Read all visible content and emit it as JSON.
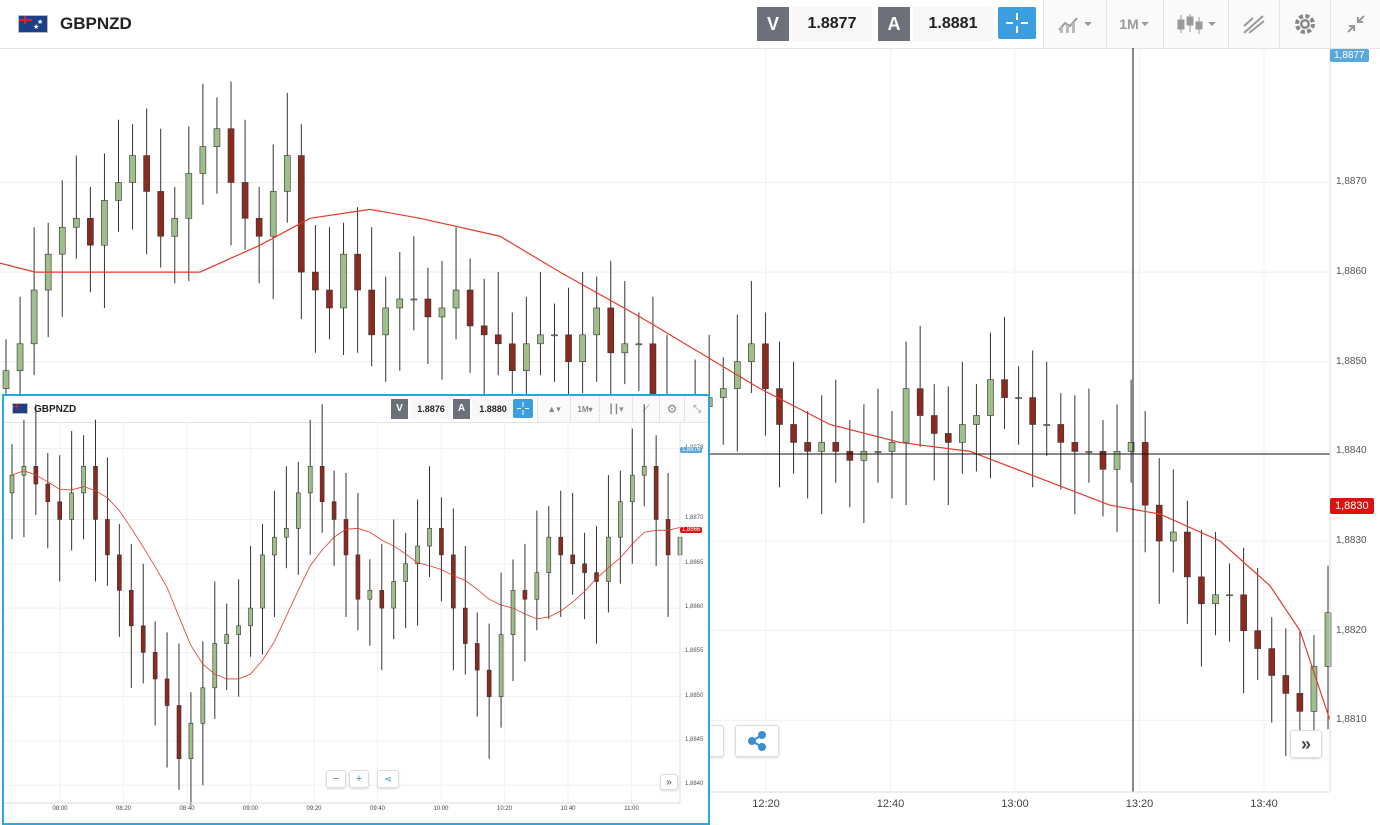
{
  "main": {
    "symbol": "GBPNZD",
    "sell_label": "V",
    "sell_price": "1.8877",
    "buy_label": "A",
    "buy_price": "1.8881",
    "timeframe": "1M",
    "current_price_tag": "1,8877",
    "ma_price_tag": "1,8830",
    "accent_color": "#3a9ee0",
    "bear_color": "#8b2a1f",
    "bull_color": "#9fbf8a",
    "ma_color": "#e53b2b"
  },
  "inset": {
    "symbol": "GBPNZD",
    "sell_label": "V",
    "sell_price": "1.8876",
    "buy_label": "A",
    "buy_price": "1.8880",
    "timeframe": "1M",
    "current_price_tag": "1,8876",
    "ma_price_tag": "1,8866",
    "zoom_out": "−",
    "zoom_in": "+"
  },
  "chart_data": [
    {
      "type": "candlestick",
      "title": "GBPNZD",
      "ylim": [
        1.8802,
        1.8885
      ],
      "yticks": [
        "1,8870",
        "1,8860",
        "1,8850",
        "1,8840",
        "1,8830",
        "1,8820",
        "1,8810"
      ],
      "xticks": [
        "12:20",
        "12:40",
        "13:00",
        "13:20",
        "13:40"
      ],
      "crosshair": {
        "time": "13:19",
        "price": 1.8835
      },
      "moving_average": [
        [
          0,
          1.8861
        ],
        [
          35,
          1.886
        ],
        [
          110,
          1.886
        ],
        [
          200,
          1.886
        ],
        [
          260,
          1.8863
        ],
        [
          310,
          1.8866
        ],
        [
          370,
          1.8867
        ],
        [
          420,
          1.8866
        ],
        [
          500,
          1.8864
        ],
        [
          560,
          1.886
        ],
        [
          640,
          1.8855
        ],
        [
          700,
          1.8851
        ],
        [
          760,
          1.8847
        ],
        [
          830,
          1.8843
        ],
        [
          900,
          1.8841
        ],
        [
          970,
          1.884
        ],
        [
          1040,
          1.8837
        ],
        [
          1110,
          1.8834
        ],
        [
          1160,
          1.8833
        ],
        [
          1220,
          1.883
        ],
        [
          1270,
          1.8825
        ],
        [
          1300,
          1.882
        ],
        [
          1330,
          1.881
        ]
      ],
      "closes": [
        1.8849,
        1.8852,
        1.8858,
        1.8862,
        1.8865,
        1.8866,
        1.8863,
        1.8868,
        1.887,
        1.8873,
        1.8869,
        1.8864,
        1.8866,
        1.8871,
        1.8874,
        1.8876,
        1.887,
        1.8866,
        1.8864,
        1.8869,
        1.8873,
        1.886,
        1.8858,
        1.8856,
        1.8862,
        1.8858,
        1.8853,
        1.8856,
        1.8857,
        1.8857,
        1.8855,
        1.8856,
        1.8858,
        1.8854,
        1.8853,
        1.8852,
        1.8849,
        1.8852,
        1.8853,
        1.8853,
        1.885,
        1.8853,
        1.8856,
        1.8851,
        1.8852,
        1.8852,
        1.8846,
        1.8838,
        1.8842,
        1.8845,
        1.8846,
        1.8847,
        1.885,
        1.8852,
        1.8847,
        1.8843,
        1.8841,
        1.884,
        1.8841,
        1.884,
        1.8839,
        1.884,
        1.884,
        1.8841,
        1.8847,
        1.8844,
        1.8842,
        1.8841,
        1.8843,
        1.8844,
        1.8848,
        1.8846,
        1.8846,
        1.8843,
        1.8843,
        1.8841,
        1.884,
        1.884,
        1.8838,
        1.884,
        1.8841,
        1.8834,
        1.883,
        1.8831,
        1.8826,
        1.8823,
        1.8824,
        1.8824,
        1.882,
        1.8818,
        1.8815,
        1.8813,
        1.8811,
        1.8816,
        1.8822
      ]
    },
    {
      "type": "candlestick",
      "title": "GBPNZD",
      "ylim": [
        1.8838,
        1.8881
      ],
      "yticks": [
        "1,8878",
        "1,8870",
        "1,8865",
        "1,8860",
        "1,8855",
        "1,8850",
        "1,8845",
        "1,8840"
      ],
      "xticks": [
        "08:00",
        "08:20",
        "08:40",
        "09:00",
        "09:20",
        "09:40",
        "10:00",
        "10:20",
        "10:40",
        "11:00"
      ],
      "closes": [
        1.8875,
        1.8876,
        1.8874,
        1.8872,
        1.887,
        1.8873,
        1.8876,
        1.887,
        1.8866,
        1.8862,
        1.8858,
        1.8855,
        1.8852,
        1.8849,
        1.8843,
        1.8847,
        1.8851,
        1.8856,
        1.8857,
        1.8858,
        1.886,
        1.8866,
        1.8868,
        1.8869,
        1.8873,
        1.8876,
        1.8872,
        1.887,
        1.8866,
        1.8861,
        1.8862,
        1.886,
        1.8863,
        1.8865,
        1.8867,
        1.8869,
        1.8866,
        1.886,
        1.8856,
        1.8853,
        1.885,
        1.8857,
        1.8862,
        1.8861,
        1.8864,
        1.8868,
        1.8866,
        1.8865,
        1.8864,
        1.8863,
        1.8868,
        1.8872,
        1.8875,
        1.8876,
        1.887,
        1.8866,
        1.8868
      ]
    }
  ]
}
